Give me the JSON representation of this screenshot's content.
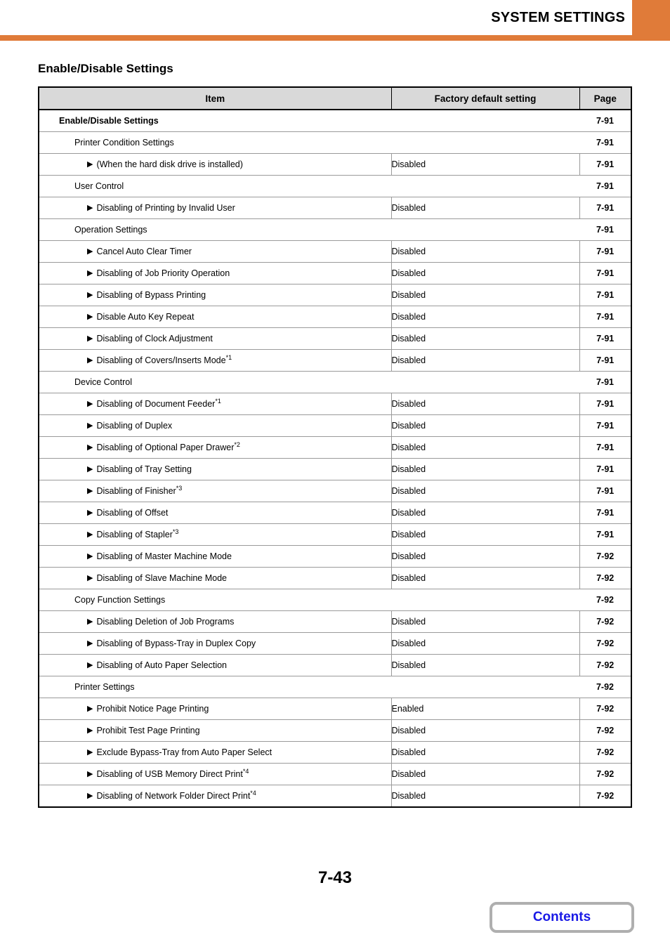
{
  "header": {
    "title": "SYSTEM SETTINGS",
    "accent_color": "#E07B39"
  },
  "page_heading": "Enable/Disable Settings",
  "table": {
    "columns": [
      "Item",
      "Factory default setting",
      "Page"
    ],
    "link_color": "#1A1AE6",
    "header_bg": "#D9D9D9",
    "rows": [
      {
        "level": 0,
        "section": true,
        "item": "Enable/Disable Settings",
        "sup": "",
        "value": "",
        "page": "7-91"
      },
      {
        "level": 1,
        "section": true,
        "item": "Printer Condition Settings",
        "sup": "",
        "value": "",
        "page": "7-91"
      },
      {
        "level": 2,
        "section": false,
        "item": "(When the hard disk drive is installed)",
        "sup": "",
        "value": "Disabled",
        "page": "7-91"
      },
      {
        "level": 1,
        "section": true,
        "item": "User Control",
        "sup": "",
        "value": "",
        "page": "7-91"
      },
      {
        "level": 2,
        "section": false,
        "item": "Disabling of Printing by Invalid User",
        "sup": "",
        "value": "Disabled",
        "page": "7-91"
      },
      {
        "level": 1,
        "section": true,
        "item": "Operation Settings",
        "sup": "",
        "value": "",
        "page": "7-91"
      },
      {
        "level": 2,
        "section": false,
        "item": "Cancel Auto Clear Timer",
        "sup": "",
        "value": "Disabled",
        "page": "7-91"
      },
      {
        "level": 2,
        "section": false,
        "item": "Disabling of Job Priority Operation",
        "sup": "",
        "value": "Disabled",
        "page": "7-91"
      },
      {
        "level": 2,
        "section": false,
        "item": "Disabling of Bypass Printing",
        "sup": "",
        "value": "Disabled",
        "page": "7-91"
      },
      {
        "level": 2,
        "section": false,
        "item": "Disable Auto Key Repeat",
        "sup": "",
        "value": "Disabled",
        "page": "7-91"
      },
      {
        "level": 2,
        "section": false,
        "item": "Disabling of Clock Adjustment",
        "sup": "",
        "value": "Disabled",
        "page": "7-91"
      },
      {
        "level": 2,
        "section": false,
        "item": "Disabling of Covers/Inserts Mode",
        "sup": "*1",
        "value": "Disabled",
        "page": "7-91"
      },
      {
        "level": 1,
        "section": true,
        "item": "Device Control",
        "sup": "",
        "value": "",
        "page": "7-91"
      },
      {
        "level": 2,
        "section": false,
        "item": "Disabling of Document Feeder",
        "sup": "*1",
        "value": "Disabled",
        "page": "7-91"
      },
      {
        "level": 2,
        "section": false,
        "item": "Disabling of Duplex",
        "sup": "",
        "value": "Disabled",
        "page": "7-91"
      },
      {
        "level": 2,
        "section": false,
        "item": "Disabling of Optional Paper Drawer",
        "sup": "*2",
        "value": "Disabled",
        "page": "7-91"
      },
      {
        "level": 2,
        "section": false,
        "item": "Disabling of Tray Setting",
        "sup": "",
        "value": "Disabled",
        "page": "7-91"
      },
      {
        "level": 2,
        "section": false,
        "item": "Disabling of Finisher",
        "sup": "*3",
        "value": "Disabled",
        "page": "7-91"
      },
      {
        "level": 2,
        "section": false,
        "item": "Disabling of Offset",
        "sup": "",
        "value": "Disabled",
        "page": "7-91"
      },
      {
        "level": 2,
        "section": false,
        "item": "Disabling of Stapler",
        "sup": "*3",
        "value": "Disabled",
        "page": "7-91"
      },
      {
        "level": 2,
        "section": false,
        "item": "Disabling of Master Machine Mode",
        "sup": "",
        "value": "Disabled",
        "page": "7-92"
      },
      {
        "level": 2,
        "section": false,
        "item": "Disabling of Slave Machine Mode",
        "sup": "",
        "value": "Disabled",
        "page": "7-92"
      },
      {
        "level": 1,
        "section": true,
        "item": "Copy Function Settings",
        "sup": "",
        "value": "",
        "page": "7-92"
      },
      {
        "level": 2,
        "section": false,
        "item": "Disabling Deletion of Job Programs",
        "sup": "",
        "value": "Disabled",
        "page": "7-92"
      },
      {
        "level": 2,
        "section": false,
        "item": "Disabling of Bypass-Tray in Duplex Copy",
        "sup": "",
        "value": "Disabled",
        "page": "7-92"
      },
      {
        "level": 2,
        "section": false,
        "item": "Disabling of Auto Paper Selection",
        "sup": "",
        "value": "Disabled",
        "page": "7-92"
      },
      {
        "level": 1,
        "section": true,
        "item": "Printer Settings",
        "sup": "",
        "value": "",
        "page": "7-92"
      },
      {
        "level": 2,
        "section": false,
        "item": "Prohibit Notice Page Printing",
        "sup": "",
        "value": "Enabled",
        "page": "7-92"
      },
      {
        "level": 2,
        "section": false,
        "item": "Prohibit Test Page Printing",
        "sup": "",
        "value": "Disabled",
        "page": "7-92"
      },
      {
        "level": 2,
        "section": false,
        "item": "Exclude Bypass-Tray from Auto Paper Select",
        "sup": "",
        "value": "Disabled",
        "page": "7-92"
      },
      {
        "level": 2,
        "section": false,
        "item": "Disabling of USB Memory Direct Print",
        "sup": "*4",
        "value": "Disabled",
        "page": "7-92"
      },
      {
        "level": 2,
        "section": false,
        "item": "Disabling of Network Folder Direct Print",
        "sup": "*4",
        "value": "Disabled",
        "page": "7-92"
      }
    ]
  },
  "footer": {
    "page_number": "7-43",
    "contents_label": "Contents"
  }
}
